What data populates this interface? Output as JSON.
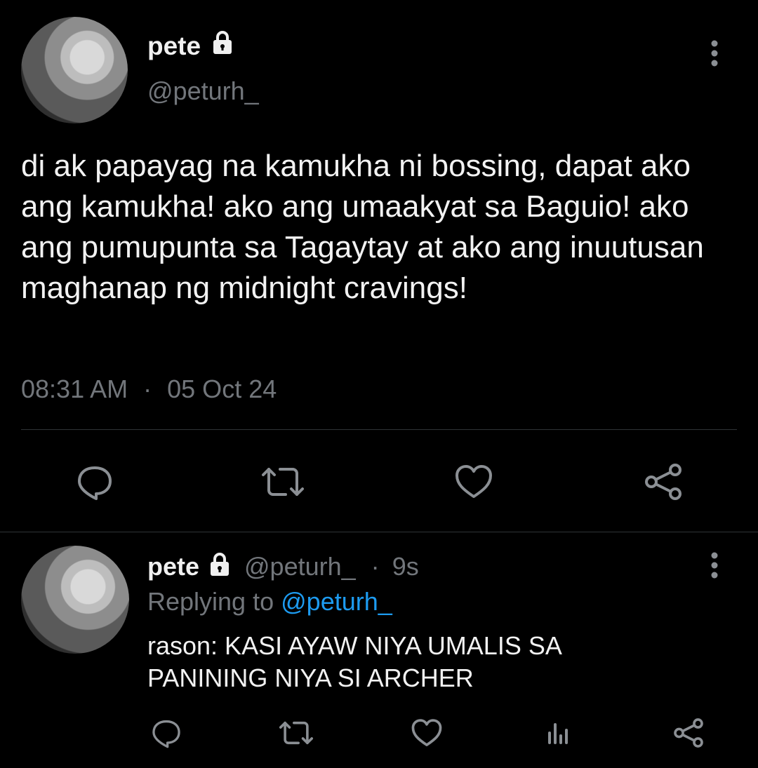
{
  "main_tweet": {
    "display_name": "pete",
    "handle": "@peturh_",
    "text": "di ak papayag na kamukha ni bossing, dapat ako ang kamukha! ako ang umaakyat sa Baguio! ako ang pumupunta sa Tagaytay at ako ang inuutusan maghanap ng midnight cravings!",
    "time": "08:31 AM",
    "separator": "·",
    "date": "05 Oct 24"
  },
  "reply_tweet": {
    "display_name": "pete",
    "handle": "@peturh_",
    "separator": "·",
    "age": "9s",
    "replying_label": "Replying to",
    "replying_handle": "@peturh_",
    "text_line1": "rason: KASI AYAW NIYA UMALIS SA",
    "text_line2": "PANINING NIYA SI ARCHER"
  },
  "icons": {
    "more": "more-vertical-icon",
    "lock": "lock-icon",
    "reply": "reply-icon",
    "retweet": "retweet-icon",
    "like": "heart-icon",
    "share": "share-icon",
    "analytics": "analytics-icon"
  },
  "colors": {
    "background": "#000000",
    "text": "#e7e9ea",
    "muted": "#72767b",
    "link": "#1d9bf0",
    "divider": "#2f3336"
  }
}
